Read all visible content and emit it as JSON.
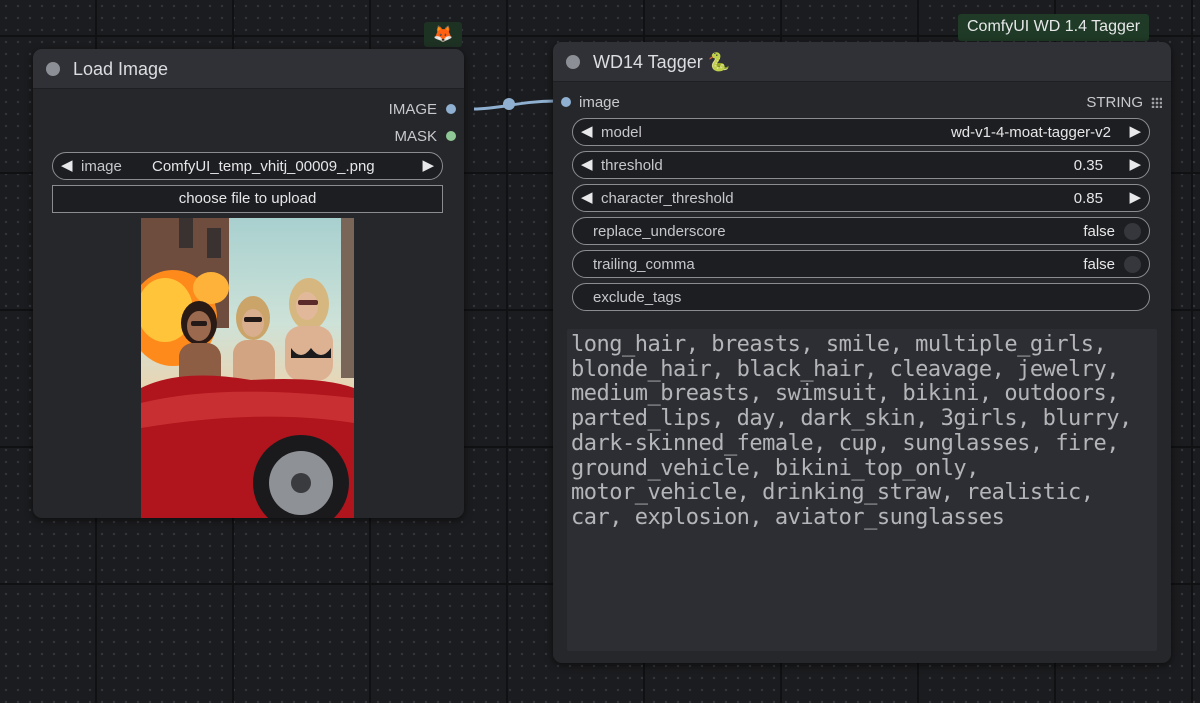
{
  "colors": {
    "canvas_bg": "#1b1c1f",
    "node_bg": "#26272b",
    "image_socket": "#8fb0d0",
    "mask_socket": "#8fc896",
    "group_label_bg": "#1f3a26"
  },
  "badge": {
    "icon": "fox-emoji",
    "glyph": "🦊"
  },
  "group": {
    "label": "ComfyUI WD 1.4 Tagger"
  },
  "load_image": {
    "title": "Load Image",
    "outputs": {
      "image": "IMAGE",
      "mask": "MASK"
    },
    "image_widget": {
      "label": "image",
      "value": "ComfyUI_temp_vhitj_00009_.png",
      "arrow_left": "◀",
      "arrow_right": "▶"
    },
    "upload_label": "choose file to upload"
  },
  "tagger": {
    "title": "WD14 Tagger",
    "title_emoji": "🐍",
    "input_label": "image",
    "output_label": "STRING",
    "widgets": {
      "model": {
        "label": "model",
        "value": "wd-v1-4-moat-tagger-v2"
      },
      "threshold": {
        "label": "threshold",
        "value": "0.35"
      },
      "character_threshold": {
        "label": "character_threshold",
        "value": "0.85"
      },
      "replace_underscore": {
        "label": "replace_underscore",
        "value": "false"
      },
      "trailing_comma": {
        "label": "trailing_comma",
        "value": "false"
      },
      "exclude_tags": {
        "label": "exclude_tags",
        "value": ""
      }
    },
    "arrows": {
      "left": "◀",
      "right": "▶"
    },
    "tags_output": "long_hair, breasts, smile, multiple_girls, blonde_hair, black_hair, cleavage, jewelry, medium_breasts, swimsuit, bikini, outdoors, parted_lips, day, dark_skin, 3girls, blurry, dark-skinned_female, cup, sunglasses, fire, ground_vehicle, bikini_top_only, motor_vehicle, drinking_straw, realistic, car, explosion, aviator_sunglasses"
  }
}
